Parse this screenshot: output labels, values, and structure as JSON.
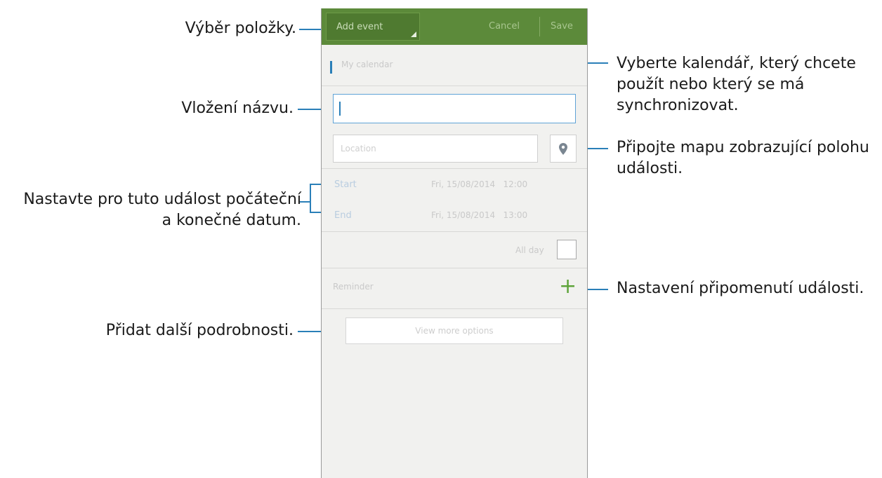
{
  "callouts": {
    "item_select": "Výběr položky.",
    "title_input": "Vložení názvu.",
    "dates_line1": "Nastavte pro tuto událost počáteční",
    "dates_line2": "a konečné datum.",
    "more_details": "Přidat další podrobnosti.",
    "calendar_line1": "Vyberte kalendář, který chcete",
    "calendar_line2": "použít nebo který se má",
    "calendar_line3": "synchronizovat.",
    "map_line1": "Připojte mapu zobrazující polohu",
    "map_line2": "události.",
    "reminder": "Nastavení připomenutí události."
  },
  "phone": {
    "topbar": {
      "add_label": "Add event",
      "cancel_label": "Cancel",
      "save_label": "Save"
    },
    "calendar_label": "My calendar",
    "title_value": "",
    "location_placeholder": "Location",
    "start_label": "Start",
    "start_value": "Fri, 15/08/2014   12:00",
    "end_label": "End",
    "end_value": "Fri, 15/08/2014   13:00",
    "all_day_label": "All day",
    "all_day_checked": false,
    "reminder_label": "Reminder",
    "more_options_label": "View more options"
  },
  "colors": {
    "accent": "#2a7fb8",
    "topbar": "#5c8a3a",
    "plus": "#5ea43a"
  },
  "icons": {
    "location": "map-pin-icon",
    "add": "plus-icon",
    "dropdown": "corner-triangle-icon"
  }
}
